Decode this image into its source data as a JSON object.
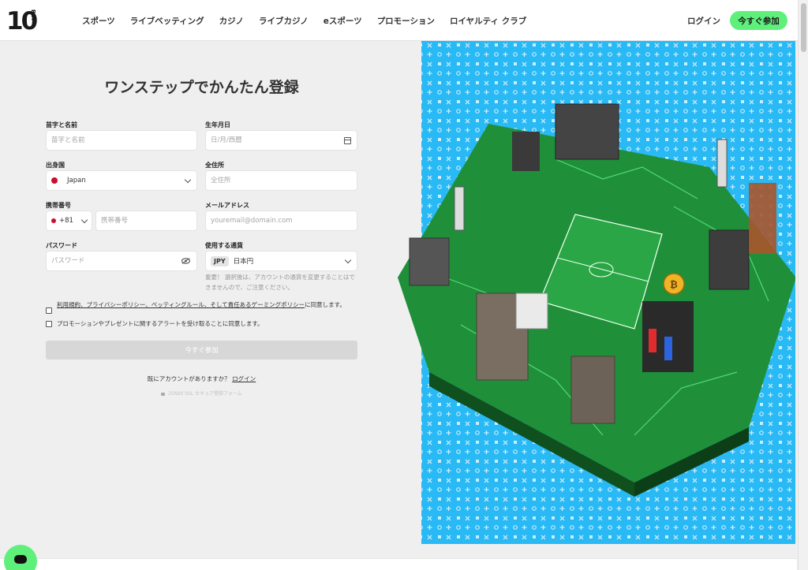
{
  "header": {
    "logo_main": "10",
    "logo_sub": "BET",
    "nav": [
      "スポーツ",
      "ライブベッティング",
      "カジノ",
      "ライブカジノ",
      "eスポーツ",
      "プロモーション",
      "ロイヤルティ クラブ"
    ],
    "login": "ログイン",
    "join": "今すぐ参加"
  },
  "form": {
    "title": "ワンステップでかんたん登録",
    "name": {
      "label": "苗字と名前",
      "placeholder": "苗字と名前"
    },
    "dob": {
      "label": "生年月日",
      "placeholder": "日/月/西暦"
    },
    "country": {
      "label": "出身国",
      "value": "Japan"
    },
    "address": {
      "label": "全住所",
      "placeholder": "全住所"
    },
    "phone": {
      "label": "携帯番号",
      "code": "+81",
      "placeholder": "携帯番号"
    },
    "email": {
      "label": "メールアドレス",
      "placeholder": "youremail@domain.com"
    },
    "password": {
      "label": "パスワード",
      "placeholder": "パスワード"
    },
    "currency": {
      "label": "使用する通貨",
      "code": "JPY",
      "value": "日本円"
    },
    "currency_note": "重要！ 選択後は、アカウントの通貨を変更することはできませんので、ご注意ください。",
    "terms": {
      "link": "利用規約、プライバシーポリシー、ベッティングルール、そして責任あるゲーミングポリシー",
      "suffix": "に同意します。"
    },
    "promo": "プロモーションやプレゼントに関するアラートを受け取ることに同意します。",
    "submit": "今すぐ参加",
    "have_account": "既にアカウントがありますか？",
    "login_link": "ログイン",
    "secure": "256bit SSL セキュア登録フォーム"
  },
  "colors": {
    "accent": "#5ff07c",
    "art_bg": "#29b9f5",
    "board": "#1f8f3a"
  }
}
